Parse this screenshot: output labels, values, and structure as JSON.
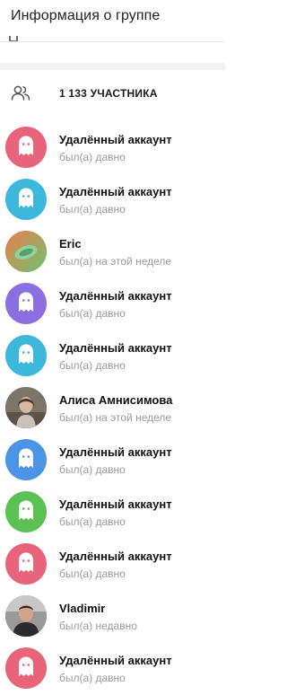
{
  "header": {
    "title": "Информация о группе"
  },
  "members": {
    "count_label": "1 133 УЧАСТНИКА"
  },
  "list": [
    {
      "name": "Удалённый аккаунт",
      "status": "был(а) давно",
      "avatar": "ghost-icon",
      "color": "#e8647a"
    },
    {
      "name": "Удалённый аккаунт",
      "status": "был(а) давно",
      "avatar": "ghost-icon",
      "color": "#3db8dc"
    },
    {
      "name": "Eric",
      "status": "был(а) на этой неделе",
      "avatar": "photo",
      "color": "#f28a5a"
    },
    {
      "name": "Удалённый аккаунт",
      "status": "был(а) давно",
      "avatar": "ghost-icon",
      "color": "#8b6fe0"
    },
    {
      "name": "Удалённый аккаунт",
      "status": "был(а) давно",
      "avatar": "ghost-icon",
      "color": "#3db8dc"
    },
    {
      "name": "Алиса Амнисимова",
      "status": "был(а) на этой неделе",
      "avatar": "photo",
      "color": "#8a7a6a"
    },
    {
      "name": "Удалённый аккаунт",
      "status": "был(а) давно",
      "avatar": "ghost-icon",
      "color": "#4c94e6"
    },
    {
      "name": "Удалённый аккаунт",
      "status": "был(а) давно",
      "avatar": "ghost-icon",
      "color": "#5cc155"
    },
    {
      "name": "Удалённый аккаунт",
      "status": "был(а) давно",
      "avatar": "ghost-icon",
      "color": "#e8647a"
    },
    {
      "name": "Vladimir",
      "status": "был(а) недавно",
      "avatar": "photo",
      "color": "#6e6e6e"
    },
    {
      "name": "Удалённый аккаунт",
      "status": "был(а) давно",
      "avatar": "ghost-icon",
      "color": "#e8647a"
    }
  ]
}
